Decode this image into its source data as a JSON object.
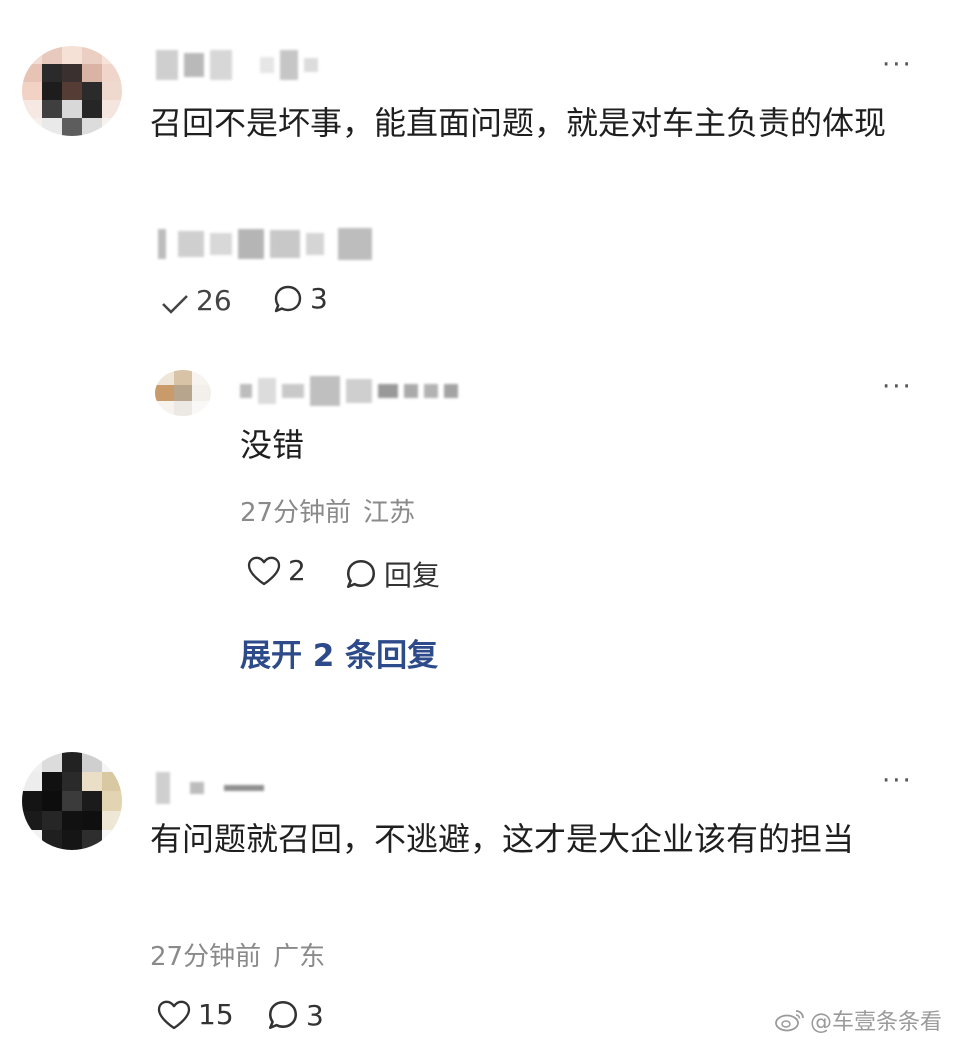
{
  "comments": [
    {
      "text": "召回不是坏事，能直面问题，就是对车主负责的体现",
      "likes": "26",
      "replies": "3",
      "reply": {
        "text": "没错",
        "time": "27分钟前",
        "location": "江苏",
        "likes": "2",
        "reply_label": "回复",
        "expand_label": "展开 2 条回复"
      }
    },
    {
      "text": "有问题就召回，不逃避，这才是大企业该有的担当",
      "time": "27分钟前",
      "location": "广东",
      "likes": "15",
      "replies": "3"
    }
  ],
  "more_label": "···",
  "watermark": "@车壹条条看",
  "icons": {
    "like": "heart-icon",
    "comment": "comment-bubble-icon",
    "more": "more-dots-icon",
    "weibo": "weibo-logo-icon"
  },
  "colors": {
    "link": "#2d4a8a",
    "meta": "#8a8a8a",
    "text": "#1f1f1f"
  }
}
